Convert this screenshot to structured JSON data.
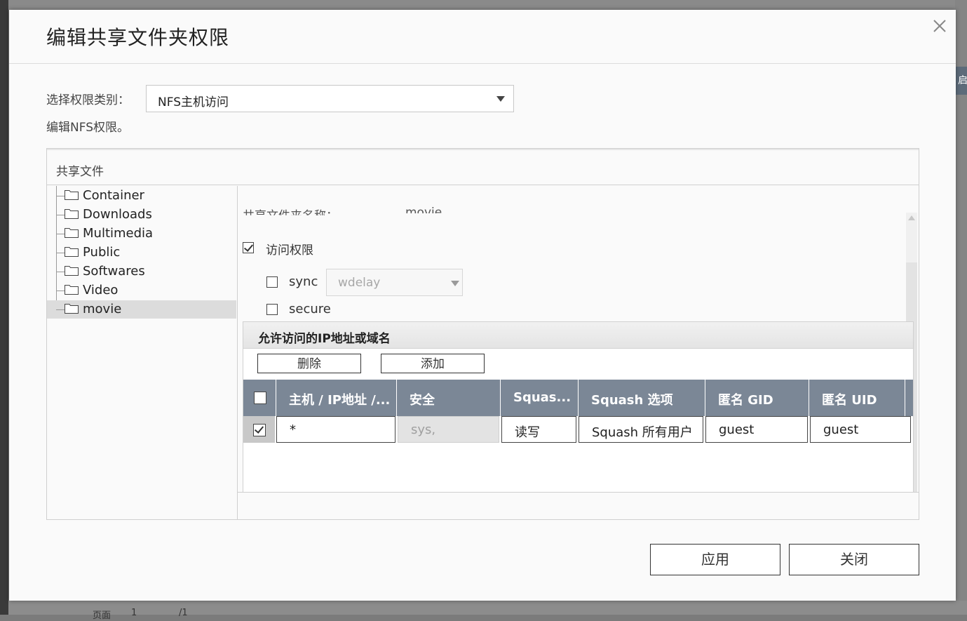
{
  "dialog": {
    "title": "编辑共享文件夹权限",
    "permission_type_label": "选择权限类别：",
    "permission_type_value": "NFS主机访问",
    "description": "编辑NFS权限。",
    "apply_label": "应用",
    "close_label": "关闭"
  },
  "panel": {
    "header": "共享文件",
    "folders": [
      "Container",
      "Downloads",
      "Multimedia",
      "Public",
      "Softwares",
      "Video",
      "movie"
    ],
    "selected_folder": "movie"
  },
  "detail": {
    "share_name_label": "共享文件夹名称：",
    "share_name_value": "movie",
    "access_label": "访问权限",
    "access_checked": true,
    "sync_label": "sync",
    "sync_checked": false,
    "wdelay_value": "wdelay",
    "secure_label": "secure",
    "secure_checked": false
  },
  "ip_section": {
    "title": "允许访问的IP地址或域名",
    "delete_label": "删除",
    "add_label": "添加",
    "columns": [
      "主机 / IP地址 /...",
      "安全",
      "Squas...",
      "Squash 选项",
      "匿名 GID",
      "匿名 UID"
    ],
    "rows": [
      {
        "checked": true,
        "host": "*",
        "security": "sys,",
        "permission": "读写",
        "squash": "Squash 所有用户",
        "gid": "guest",
        "uid": "guest"
      }
    ]
  },
  "background": {
    "pager_label": "页面",
    "pager_page": "1",
    "pager_total": "/1",
    "right_tab": "启"
  },
  "colors": {
    "table_header": "#7b8796",
    "selected_row": "#dcdcdc",
    "dialog_bg": "#fafafa"
  },
  "icons": {
    "close": "close-icon",
    "folder": "folder-icon",
    "dropdown": "chevron-down-icon"
  }
}
